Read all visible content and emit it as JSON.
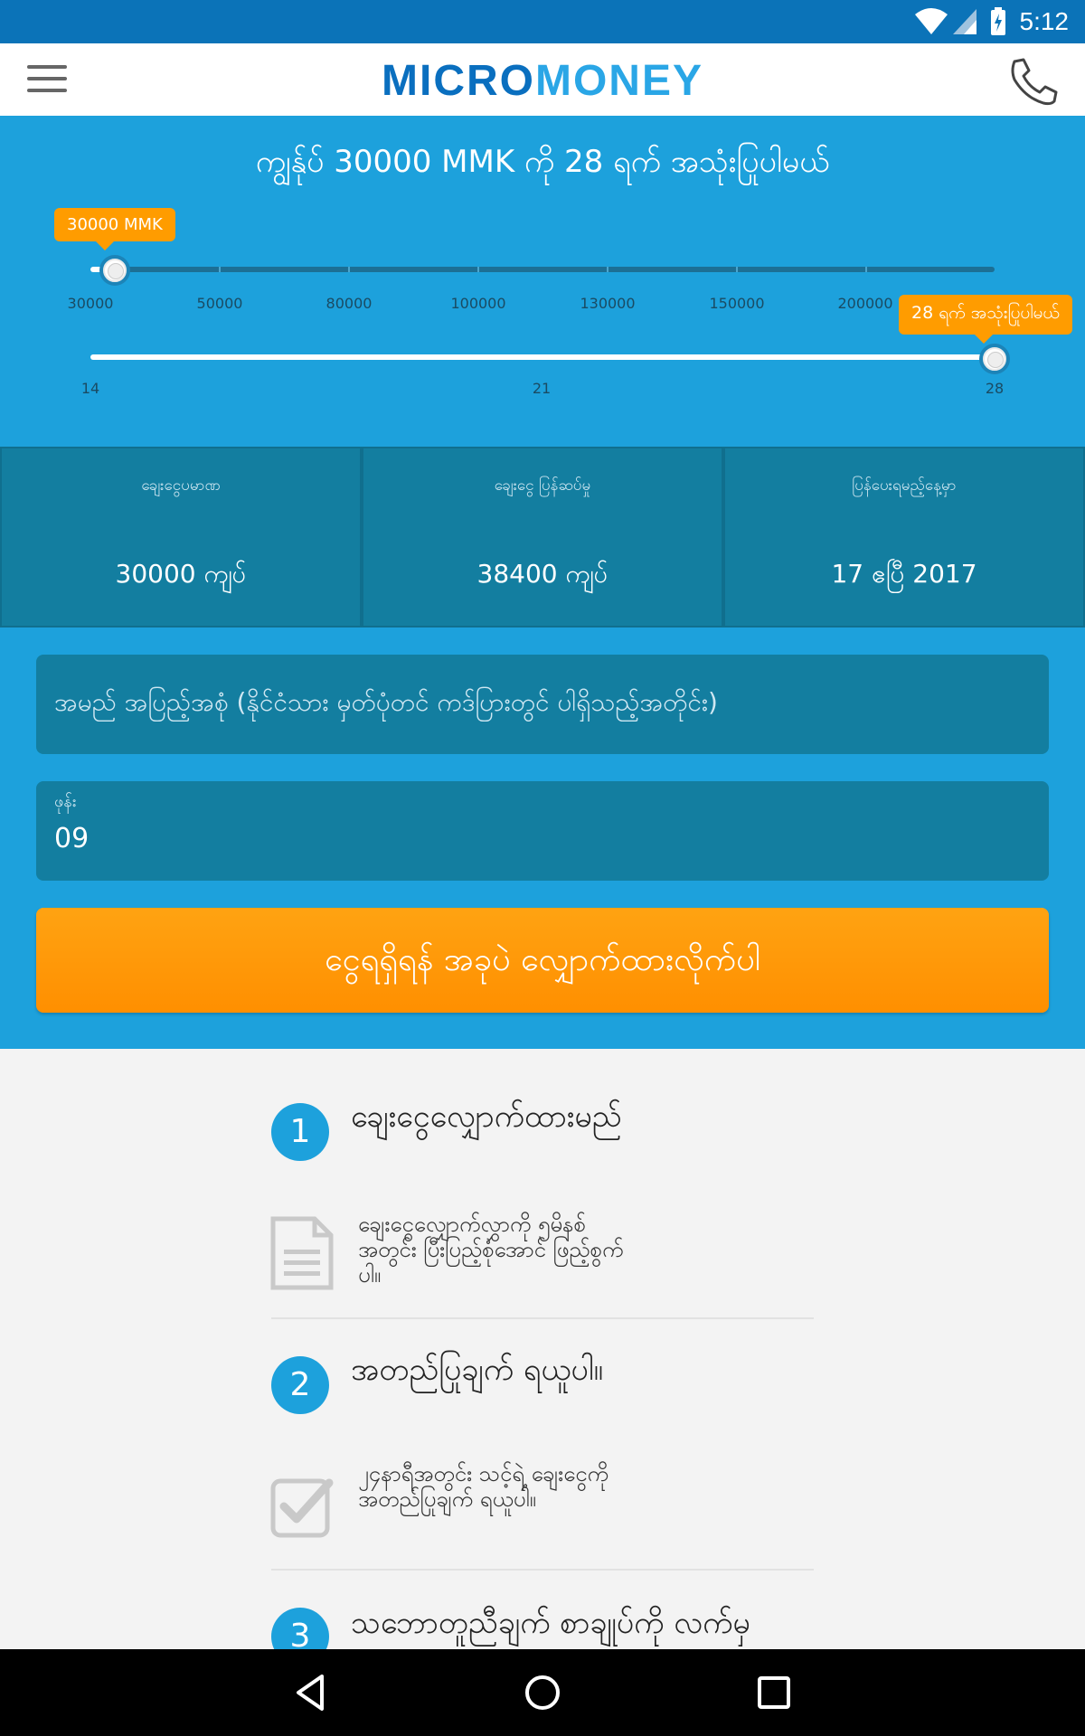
{
  "status": {
    "time": "5:12"
  },
  "appbar": {
    "logo_part1": "MICRO",
    "logo_part2": "MONEY"
  },
  "loan": {
    "headline": "ကျွန်ုပ် 30000 MMK ကို 28 ရက် အသုံးပြုပါမယ်",
    "amount_bubble": "30000 MMK",
    "amount_ticks": [
      "30000",
      "50000",
      "80000",
      "100000",
      "130000",
      "150000",
      "200000"
    ],
    "days_bubble": "28 ရက် အသုံးပြုပါမယ်",
    "days_ticks": [
      "14",
      "21",
      "28"
    ],
    "amount_fraction": 0.0,
    "days_fraction": 1.0
  },
  "stats": [
    {
      "caption": "ချေးငွေပမာဏ",
      "value": "30000 ကျပ်"
    },
    {
      "caption": "ချေးငွေ ပြန်ဆပ်မှု",
      "value": "38400 ကျပ်"
    },
    {
      "caption": "ပြန်ပေးရမည့်နေ့မှာ",
      "value": "17 ဧပြီ 2017"
    }
  ],
  "form": {
    "name_placeholder": "အမည် အပြည့်အစုံ (နိုင်ငံသား မှတ်ပုံတင် ကဒ်ပြားတွင် ပါရှိသည့်အတိုင်း)",
    "phone_label": "ဖုန်း",
    "phone_value": "09",
    "submit_label": "ငွေရရှိရန် အခုပဲ လျှောက်ထားလိုက်ပါ"
  },
  "steps": [
    {
      "num": "1",
      "title": "ချေးငွေလျှောက်ထားမည်",
      "desc": "ချေးငွေလျှောက်လွှာကို ၅မိနစ်အတွင်း ပြီးပြည့်စုံအောင် ဖြည့်စွက်ပါ။",
      "icon": "document-icon"
    },
    {
      "num": "2",
      "title": "အတည်ပြုချက် ရယူပါ။",
      "desc": "၂၄နာရီအတွင်း သင့်ရဲ့ ချေးငွေကို အတည်ပြုချက် ရယူပါ။",
      "icon": "checkbox-icon"
    },
    {
      "num": "3",
      "title": "သဘောတူညီချက် စာချုပ်ကို လက်မှ"
    }
  ]
}
